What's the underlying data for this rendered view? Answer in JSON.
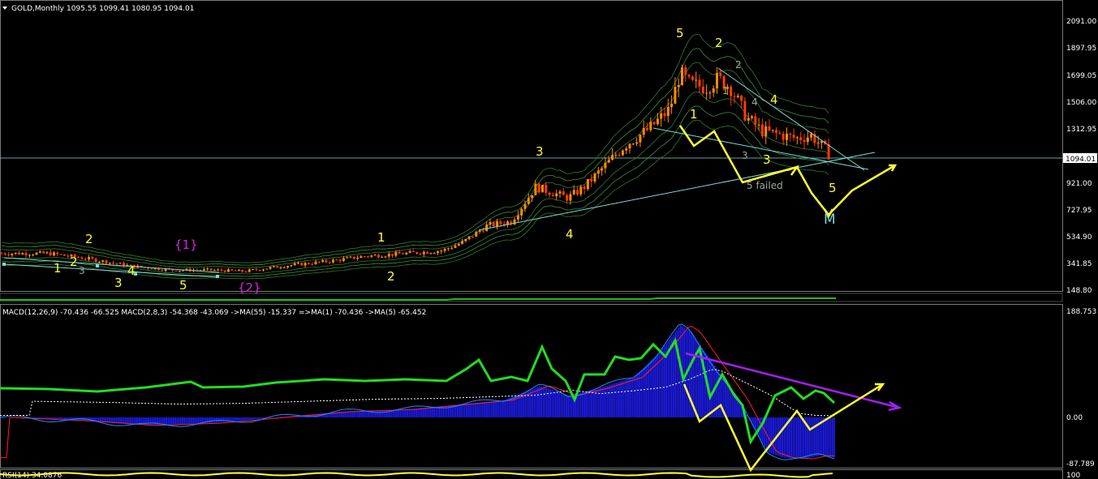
{
  "colors": {
    "background": "#000000",
    "grid": "#7a7a7a",
    "text": "#ffffff",
    "candle_up": "#ff8c00",
    "candle_down": "#ff3b00",
    "bands": "#2f7a2f",
    "trendline": "#7fd9d9",
    "annotation": "#ffff33",
    "wave_label": "#ffff33",
    "magenta_label": "#e020e0",
    "macd_hist": "#1f1fff",
    "macd_fast": "#1a8cff",
    "macd_signal": "#ff2020",
    "green_ma": "#22dd22",
    "diverge": "#a020f0",
    "dotted_ma": "#ffffff"
  },
  "header": {
    "title": "GOLD,Monthly",
    "ohlc": "1095.55 1099.41 1080.95 1094.01"
  },
  "macd_header": "MACD(12,26,9) -70.436 -66.525  MACD(2,8,3) -54.368 -43.069  ->MA(55) -15.337  =>MA(1) -70.436  ->MA(5) -65.452",
  "bottom_header": "RSI(14) 34.0876",
  "price_axis": {
    "ticks": [
      "2091.00",
      "1897.95",
      "1699.05",
      "1506.00",
      "1312.95",
      "921.00",
      "727.95",
      "534.90",
      "341.85",
      "148.80"
    ],
    "current": "1094.01"
  },
  "macd_axis": {
    "ticks": [
      "188.753",
      "0.00",
      "-87.789"
    ]
  },
  "bottom_axis": {
    "ticks": [
      "100"
    ]
  },
  "labels": {
    "w1": "1",
    "w2": "2",
    "w3": "3",
    "w4": "4",
    "w5": "5",
    "w1b": "1",
    "w2b": "2",
    "w3b": "3",
    "w4b": "4",
    "w5b": "5",
    "w2top": "2",
    "w3left": "3",
    "w5left": "5",
    "curly1": "{1}",
    "curly2": "{2}",
    "n1": "1",
    "n2": "2",
    "n3": "3",
    "n4": "4",
    "peak5": "5",
    "peak2": "2",
    "c1": "1",
    "c4": "4",
    "c3": "3",
    "c5": "5",
    "g2": "2",
    "g1": "1",
    "g4": "4",
    "g3": "3",
    "failed": "5 failed",
    "m": "M"
  },
  "chart_data": [
    {
      "type": "candlestick",
      "title": "GOLD,Monthly",
      "price_ticks": [
        2091.0,
        1897.95,
        1699.05,
        1506.0,
        1312.95,
        921.0,
        727.95,
        534.9,
        341.85,
        148.8
      ],
      "ylim": [
        148.8,
        2091.0
      ],
      "last": {
        "open": 1095.55,
        "high": 1099.41,
        "low": 1080.95,
        "close": 1094.01
      },
      "approx_close_path": [
        [
          0,
          420
        ],
        [
          60,
          420
        ],
        [
          110,
          380
        ],
        [
          160,
          330
        ],
        [
          210,
          300
        ],
        [
          260,
          300
        ],
        [
          300,
          290
        ],
        [
          350,
          330
        ],
        [
          400,
          360
        ],
        [
          450,
          400
        ],
        [
          500,
          420
        ],
        [
          545,
          440
        ],
        [
          570,
          500
        ],
        [
          600,
          620
        ],
        [
          630,
          650
        ],
        [
          660,
          900
        ],
        [
          685,
          850
        ],
        [
          700,
          820
        ],
        [
          720,
          900
        ],
        [
          745,
          1050
        ],
        [
          770,
          1200
        ],
        [
          800,
          1320
        ],
        [
          825,
          1460
        ],
        [
          838,
          1720
        ],
        [
          850,
          1640
        ],
        [
          870,
          1620
        ],
        [
          885,
          1680
        ],
        [
          900,
          1620
        ],
        [
          920,
          1400
        ],
        [
          940,
          1300
        ],
        [
          960,
          1280
        ],
        [
          980,
          1250
        ],
        [
          1000,
          1270
        ],
        [
          1020,
          1150
        ],
        [
          1025,
          1094
        ]
      ]
    },
    {
      "type": "line",
      "title": "MACD(12,26,9) -70.436 -66.525",
      "ylim": [
        -87.789,
        188.753
      ],
      "ticks": [
        188.753,
        0.0,
        -87.789
      ],
      "series": [
        {
          "name": "MACD(12,26,9)",
          "last": -70.436
        },
        {
          "name": "signal",
          "last": -66.525
        },
        {
          "name": "MACD(2,8,3)",
          "last": -54.368
        },
        {
          "name": "MA(55)",
          "last": -15.337
        },
        {
          "name": "MA(1)",
          "last": -70.436
        },
        {
          "name": "MA(5)",
          "last": -65.452
        }
      ]
    }
  ]
}
